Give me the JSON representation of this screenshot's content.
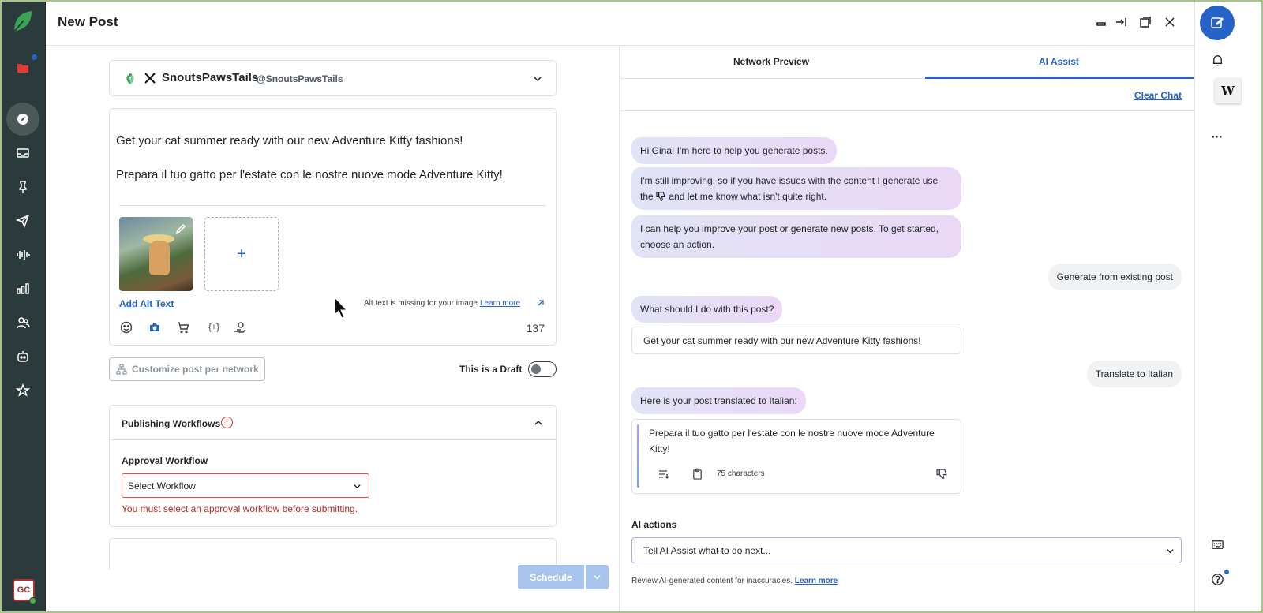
{
  "window": {
    "title": "New Post"
  },
  "left_rail": {
    "icons": [
      "logo-leaf-icon",
      "folder-icon",
      "compass-icon",
      "inbox-icon",
      "pin-icon",
      "send-icon",
      "listening-icon",
      "reports-icon",
      "people-icon",
      "bot-icon",
      "star-icon"
    ],
    "user_initials": "GC"
  },
  "profile": {
    "name": "SnoutsPawsTails",
    "handle": "@SnoutsPawsTails"
  },
  "editor": {
    "line1": "Get your cat summer ready with our new Adventure Kitty fashions!",
    "line2": "Prepara il tuo gatto per l'estate con le nostre nuove mode Adventure Kitty!",
    "add_media_symbol": "+",
    "alt_text_link": "Add Alt Text",
    "alt_text_message": "Alt text is missing for your image",
    "learn_more": "Learn more",
    "variables_symbol": "{+}",
    "char_count": "137"
  },
  "options": {
    "customize_label": "Customize post per network",
    "draft_label": "This is a Draft",
    "draft_on": false
  },
  "workflows": {
    "title": "Publishing Workflows",
    "warn_symbol": "!",
    "approval_label": "Approval Workflow",
    "select_placeholder": "Select Workflow",
    "error": "You must select an approval workflow before submitting."
  },
  "footer": {
    "schedule_label": "Schedule"
  },
  "ai_panel": {
    "tabs": [
      "Network Preview",
      "AI Assist"
    ],
    "active_tab": "AI Assist",
    "clear_chat": "Clear Chat",
    "messages": {
      "bot1": "Hi Gina! I'm here to help you generate posts.",
      "bot2_a": "I'm still improving, so if you have issues with the content I generate use",
      "bot2_b": "the",
      "bot2_c": "and let me know what isn't quite right.",
      "bot3": "I can help you improve your post or generate new posts. To get started, choose an action.",
      "user1": "Generate from existing post",
      "bot4": "What should I do with this post?",
      "quote1": "Get your cat summer ready with our new Adventure Kitty fashions!",
      "user2": "Translate to Italian",
      "bot5": "Here is your post translated to Italian:",
      "result": "Prepara il tuo gatto per l'estate con le nostre nuove mode Adventure Kitty!",
      "result_chars": "75 characters"
    },
    "ai_actions_label": "AI actions",
    "ai_input_placeholder": "Tell AI Assist what to do next...",
    "disclaimer": "Review AI-generated content for inaccuracies.",
    "disclaimer_link": "Learn more"
  },
  "right_rail": {
    "badge": "W",
    "more_symbol": "···"
  },
  "colors": {
    "rail": "#2b3a3a",
    "accent": "#2563c9",
    "error": "#b32b2b",
    "brand_green": "#3aa655"
  }
}
